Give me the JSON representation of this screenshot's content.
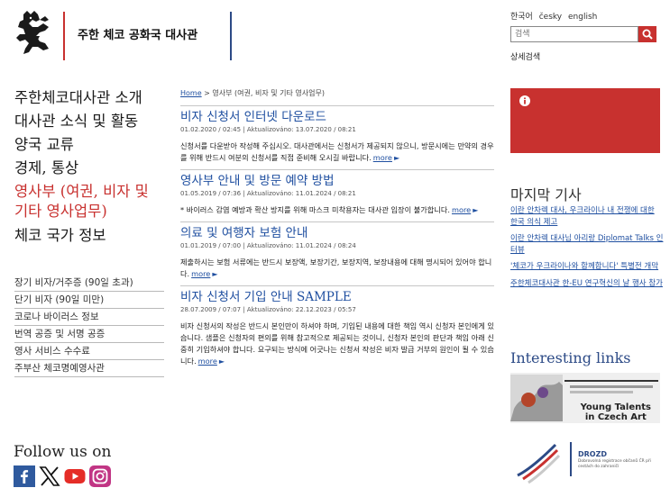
{
  "header": {
    "site_title": "주한 체코 공화국 대사관",
    "languages": [
      "한국어",
      "česky",
      "english"
    ],
    "search_placeholder": "검색",
    "advanced_search": "상세검색"
  },
  "main_nav": [
    "주한체코대사관 소개",
    "대사관 소식 및 활동",
    "양국 교류",
    "경제, 통상",
    "영사부 (여권, 비자 및 기타 영사업무)",
    "체코 국가 정보"
  ],
  "active_nav_index": 4,
  "sub_nav": [
    "장기 비자/거주증 (90일 초과)",
    "단기 비자 (90일 미만)",
    "코로나 바이러스 정보",
    "번역 공증 및 서명 공증",
    "영사 서비스 수수료",
    "주부산 체코명예영사관"
  ],
  "breadcrumb": {
    "home": "Home",
    "rest": " > 영사부 (여권, 비자 및 기타 영사업무)"
  },
  "articles": [
    {
      "title": "비자 신청서 인터넷 다운로드",
      "date": "01.02.2020 / 02:45 | Aktualizováno: 13.07.2020 / 08:21",
      "body": "신청서를 다운받아 작성해 주십시오. 대사관에서는 신청서가 제공되지 않으니, 방문시에는 만약의 경우를 위해 반드시 여분의 신청서를 직접 준비해 오시길 바랍니다.",
      "more": "more"
    },
    {
      "title": "영사부 안내 및 방문 예약 방법",
      "date": "01.05.2019 / 07:36 | Aktualizováno: 11.01.2024 / 08:21",
      "body": "* 바이러스 감염 예방과 확산 방지를 위해 마스크 미착용자는 대사관 입장이 불가합니다.",
      "more": "more"
    },
    {
      "title": "의료 및 여행자 보험 안내",
      "date": "01.01.2019 / 07:00 | Aktualizováno: 11.01.2024 / 08:24",
      "body": "제출하시는 보험 서류에는 반드시 보장액, 보장기간, 보장지역, 보장내용에 대해 명시되어 있어야 합니다.",
      "more": "more"
    },
    {
      "title": "비자 신청서 기입 안내 SAMPLE",
      "date": "28.07.2009 / 07:07 | Aktualizováno: 22.12.2023 / 05:57",
      "body": "비자 신청서의 작성은 반드시 본인만이 하셔야 하며, 기입된 내용에 대한 책임 역시 신청자 본인에게 있습니다. 샘플은 신청자의 편의를 위해 참고적으로 제공되는 것이니, 신청자 본인의 판단과 책임 아래 신중히 기입하셔야 합니다. 요구되는 방식에 어긋나는 신청서 작성은 비자 발급 거부의 원인이 될 수 있습니다.",
      "more": "more"
    }
  ],
  "recent": {
    "title": "마지막 기사",
    "items": [
      "이란 안차렉 대사, 우크라이나 내 전쟁에 대한 한국 의식 제고",
      "이란 안차렉 대사님 아리랑 Diplomat Talks 인터뷰",
      "'체코가 우크라이나와 함께합니다' 특별전 개막",
      "주한체코대사관 한-EU 연구혁신의 날 행사 참가"
    ]
  },
  "links": {
    "title": "Interesting links",
    "banner1_line1": "Young Talents",
    "banner1_line2": "in Czech Art",
    "banner2_name": "DROZD",
    "banner2_sub": "Dobrovolná registrace občanů ČR při cestách do zahraničí"
  },
  "follow": {
    "title": "Follow us on",
    "networks": [
      "facebook-icon",
      "x-icon",
      "youtube-icon",
      "instagram-icon"
    ]
  },
  "colors": {
    "accent_red": "#c8312f",
    "link_blue": "#1f4fa0",
    "navy": "#2c4a86"
  }
}
